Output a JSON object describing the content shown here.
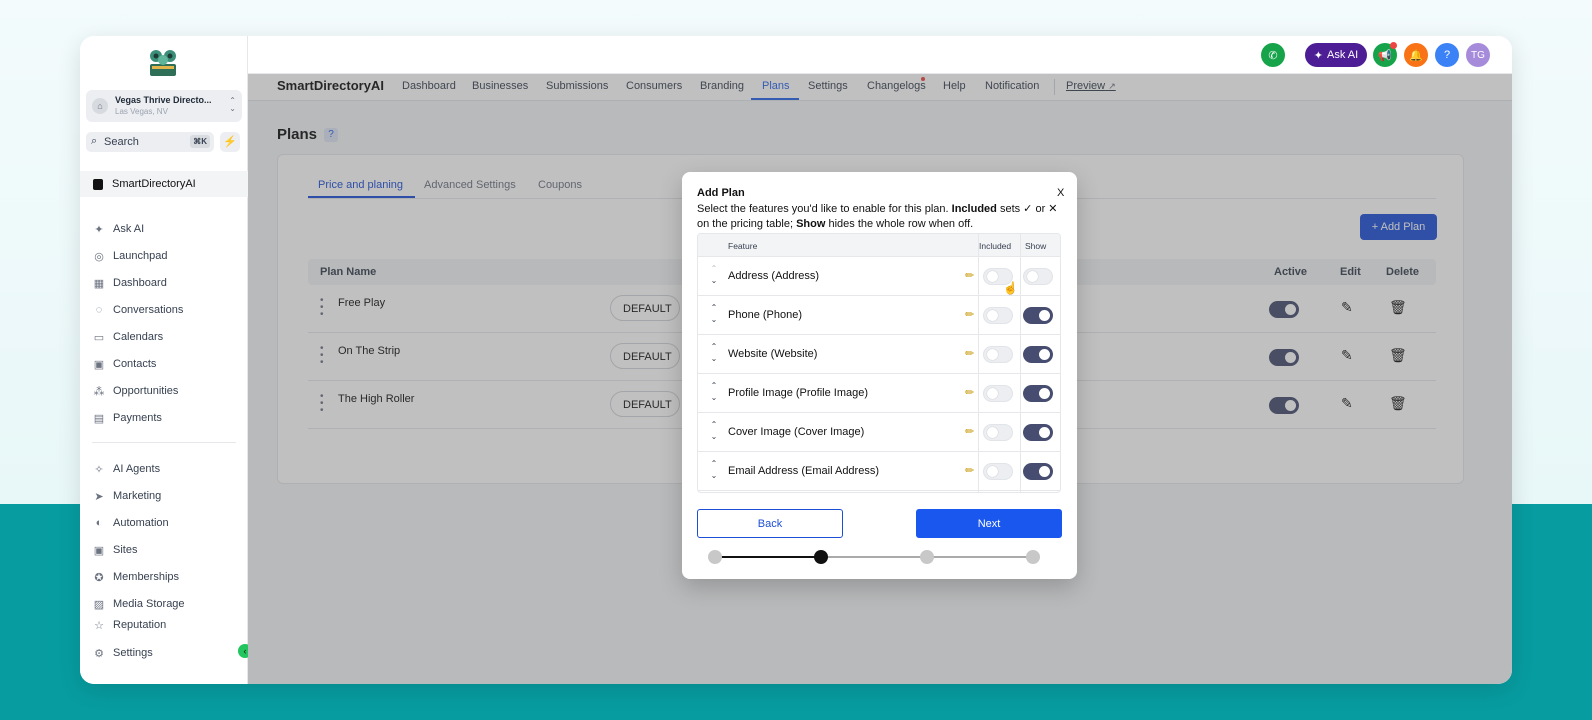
{
  "app": {
    "workspace": "SmartDirectoryAI",
    "location_name": "Vegas Thrive Directo...",
    "location_city": "Las Vegas, NV"
  },
  "search": {
    "label": "Search",
    "shortcut": "⌘K"
  },
  "sidebar": {
    "items": [
      {
        "label": "Ask AI",
        "icon": "sparkle-icon"
      },
      {
        "label": "Launchpad",
        "icon": "rocket-icon"
      },
      {
        "label": "Dashboard",
        "icon": "grid-icon"
      },
      {
        "label": "Conversations",
        "icon": "chat-icon"
      },
      {
        "label": "Calendars",
        "icon": "calendar-icon"
      },
      {
        "label": "Contacts",
        "icon": "contact-card-icon"
      },
      {
        "label": "Opportunities",
        "icon": "opportunities-icon"
      },
      {
        "label": "Payments",
        "icon": "receipt-icon"
      }
    ],
    "items2": [
      {
        "label": "AI Agents",
        "icon": "ai-agent-icon"
      },
      {
        "label": "Marketing",
        "icon": "send-icon"
      },
      {
        "label": "Automation",
        "icon": "automation-icon"
      },
      {
        "label": "Sites",
        "icon": "sites-icon"
      },
      {
        "label": "Memberships",
        "icon": "award-icon"
      },
      {
        "label": "Media Storage",
        "icon": "image-icon"
      },
      {
        "label": "Reputation",
        "icon": "star-icon"
      }
    ],
    "settings_label": "Settings"
  },
  "topbar": {
    "ask_ai": "Ask AI",
    "avatar": "TG",
    "help": "?"
  },
  "subnav": {
    "brand": "SmartDirectoryAI",
    "items": [
      "Dashboard",
      "Businesses",
      "Submissions",
      "Consumers",
      "Branding",
      "Plans",
      "Settings",
      "Changelogs",
      "Help",
      "Notification"
    ],
    "active": "Plans",
    "preview": "Preview"
  },
  "page": {
    "title": "Plans",
    "help": "?"
  },
  "tabs": [
    "Price and planing",
    "Advanced Settings",
    "Coupons"
  ],
  "add_plan": "+ Add Plan",
  "table": {
    "headers": {
      "name": "Plan Name",
      "active": "Active",
      "edit": "Edit",
      "delete": "Delete"
    },
    "rows": [
      {
        "name": "Free Play",
        "badge": "DEFAULT",
        "active": true
      },
      {
        "name": "On The Strip",
        "badge": "DEFAULT",
        "active": true
      },
      {
        "name": "The High Roller",
        "badge": "DEFAULT",
        "active": true
      }
    ]
  },
  "modal": {
    "title": "Add Plan",
    "close": "X",
    "desc_1": "Select the features you'd like to enable for this plan. ",
    "desc_bold_1": "Included",
    "desc_2": " sets ✓ or ✕ on the pricing table; ",
    "desc_bold_2": "Show",
    "desc_3": " hides the whole row when off.",
    "columns": {
      "feature": "Feature",
      "included": "Included",
      "show": "Show"
    },
    "features": [
      {
        "name": "Address (Address)",
        "included": false,
        "show": false
      },
      {
        "name": "Phone (Phone)",
        "included": false,
        "show": true
      },
      {
        "name": "Website (Website)",
        "included": false,
        "show": true
      },
      {
        "name": "Profile Image (Profile Image)",
        "included": false,
        "show": true
      },
      {
        "name": "Cover Image (Cover Image)",
        "included": false,
        "show": true
      },
      {
        "name": "Email Address (Email Address)",
        "included": false,
        "show": true
      }
    ],
    "back": "Back",
    "next": "Next",
    "steps_total": 4,
    "current_step": 2
  },
  "colors": {
    "primary": "#1a57ee",
    "toggle_on": "#474d70",
    "teal_bg": "#079ca0",
    "ask_ai": "#4c1d95"
  }
}
